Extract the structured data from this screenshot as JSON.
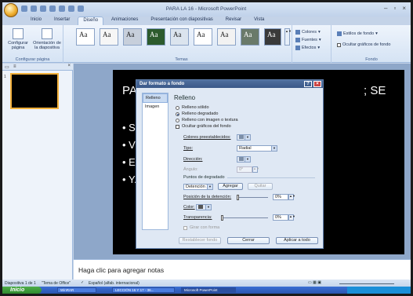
{
  "app": {
    "title": "PARA LA 16 - Microsoft PowerPoint"
  },
  "tabs": [
    "Inicio",
    "Insertar",
    "Diseño",
    "Animaciones",
    "Presentación con diapositivas",
    "Revisar",
    "Vista"
  ],
  "ribbon": {
    "config_group": {
      "setup_label": "Configurar página",
      "orientation_label": "Orientación de la diapositiva",
      "group_label": "Configurar página"
    },
    "themes_group": {
      "theme_sample": "Aa",
      "group_label": "Temas"
    },
    "theme_options": {
      "colors": "Colores",
      "fonts": "Fuentes",
      "effects": "Efectos"
    },
    "background_group": {
      "styles": "Estilos de fondo",
      "hide_graphics": "Ocultar gráficos de fondo",
      "group_label": "Fondo"
    }
  },
  "left_pane": {
    "slide_number": "1"
  },
  "slide": {
    "title_start": "PA",
    "title_end": "; SE",
    "bullets": [
      "Sa",
      "Vc",
      "Es",
      "Y."
    ]
  },
  "notes": {
    "placeholder": "Haga clic para agregar notas"
  },
  "dialog": {
    "title": "Dar formato a fondo",
    "help": "?",
    "close": "×",
    "nav": [
      "Relleno",
      "Imagen"
    ],
    "heading": "Relleno",
    "fill_options": [
      {
        "label": "Relleno sólido",
        "selected": false
      },
      {
        "label": "Relleno degradado",
        "selected": true
      },
      {
        "label": "Relleno con imagen o textura",
        "selected": false
      }
    ],
    "hide_graphics": "Ocultar gráficos del fondo",
    "preset_colors_label": "Colores preestablecidos:",
    "type_label": "Tipo:",
    "type_value": "Radial",
    "direction_label": "Dirección:",
    "angle_label": "Ángulo:",
    "angle_value": "0°",
    "stops_section": "Puntos de degradado",
    "stop_value": "Detención 1",
    "add_button": "Agregar",
    "remove_button": "Quitar",
    "stop_position_label": "Posición de la detención:",
    "stop_position_value": "0%",
    "color_label": "Color:",
    "transparency_label": "Transparencia:",
    "transparency_value": "0%",
    "rotate_label": "Girar con forma",
    "reset_button": "Restablecer fondo",
    "close_button": "Cerrar",
    "apply_all_button": "Aplicar a todo"
  },
  "statusbar": {
    "slide_info": "Diapositiva 1 de 1",
    "theme": "\"Tema de Office\"",
    "language": "Español (alfab. internacional)"
  },
  "taskbar": {
    "start": "Inicio",
    "tasks": [
      "WinRAR",
      "LECCIÓN 16 Y 17 - 36...",
      "Microsoft PowerPoint"
    ]
  }
}
